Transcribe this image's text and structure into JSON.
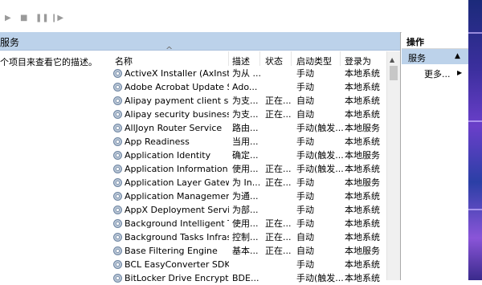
{
  "toolbar": {
    "play": "▶",
    "stop": "■",
    "pause": "❚❚",
    "resume": "❙▶"
  },
  "left_pane": {
    "title": "服务",
    "description": "个项目来查看它的描述。"
  },
  "columns": {
    "name": "名称",
    "desc": "描述",
    "status": "状态",
    "startup": "启动类型",
    "logon": "登录为"
  },
  "rows": [
    {
      "name": "ActiveX Installer (AxInstSV)",
      "desc": "为从 ...",
      "status": "",
      "startup": "手动",
      "logon": "本地系统"
    },
    {
      "name": "Adobe Acrobat Update S...",
      "desc": "Ado...",
      "status": "",
      "startup": "手动",
      "logon": "本地系统"
    },
    {
      "name": "Alipay payment client sec...",
      "desc": "为支...",
      "status": "正在...",
      "startup": "自动",
      "logon": "本地系统"
    },
    {
      "name": "Alipay security business s...",
      "desc": "为支...",
      "status": "正在...",
      "startup": "自动",
      "logon": "本地系统"
    },
    {
      "name": "AllJoyn Router Service",
      "desc": "路由...",
      "status": "",
      "startup": "手动(触发...",
      "logon": "本地服务"
    },
    {
      "name": "App Readiness",
      "desc": "当用...",
      "status": "",
      "startup": "手动",
      "logon": "本地系统"
    },
    {
      "name": "Application Identity",
      "desc": "确定...",
      "status": "",
      "startup": "手动(触发...",
      "logon": "本地服务"
    },
    {
      "name": "Application Information",
      "desc": "使用...",
      "status": "正在...",
      "startup": "手动(触发...",
      "logon": "本地系统"
    },
    {
      "name": "Application Layer Gatewa...",
      "desc": "为 In...",
      "status": "正在...",
      "startup": "手动",
      "logon": "本地服务"
    },
    {
      "name": "Application Management",
      "desc": "为通...",
      "status": "",
      "startup": "手动",
      "logon": "本地系统"
    },
    {
      "name": "AppX Deployment Servic...",
      "desc": "为部...",
      "status": "",
      "startup": "手动",
      "logon": "本地系统"
    },
    {
      "name": "Background Intelligent T...",
      "desc": "使用...",
      "status": "正在...",
      "startup": "手动",
      "logon": "本地系统"
    },
    {
      "name": "Background Tasks Infras...",
      "desc": "控制...",
      "status": "正在...",
      "startup": "自动",
      "logon": "本地系统"
    },
    {
      "name": "Base Filtering Engine",
      "desc": "基本...",
      "status": "正在...",
      "startup": "自动",
      "logon": "本地服务"
    },
    {
      "name": "BCL EasyConverter SDK ...",
      "desc": "",
      "status": "",
      "startup": "手动",
      "logon": "本地系统"
    },
    {
      "name": "BitLocker Drive Encryptio...",
      "desc": "BDE...",
      "status": "",
      "startup": "手动(触发...",
      "logon": "本地系统"
    }
  ],
  "actions_panel": {
    "title": "操作",
    "section": "服务",
    "more": "更多..."
  },
  "colors": {
    "selection_band": "#bcd2ea",
    "toolbar_icons": "#9a9a9a"
  }
}
